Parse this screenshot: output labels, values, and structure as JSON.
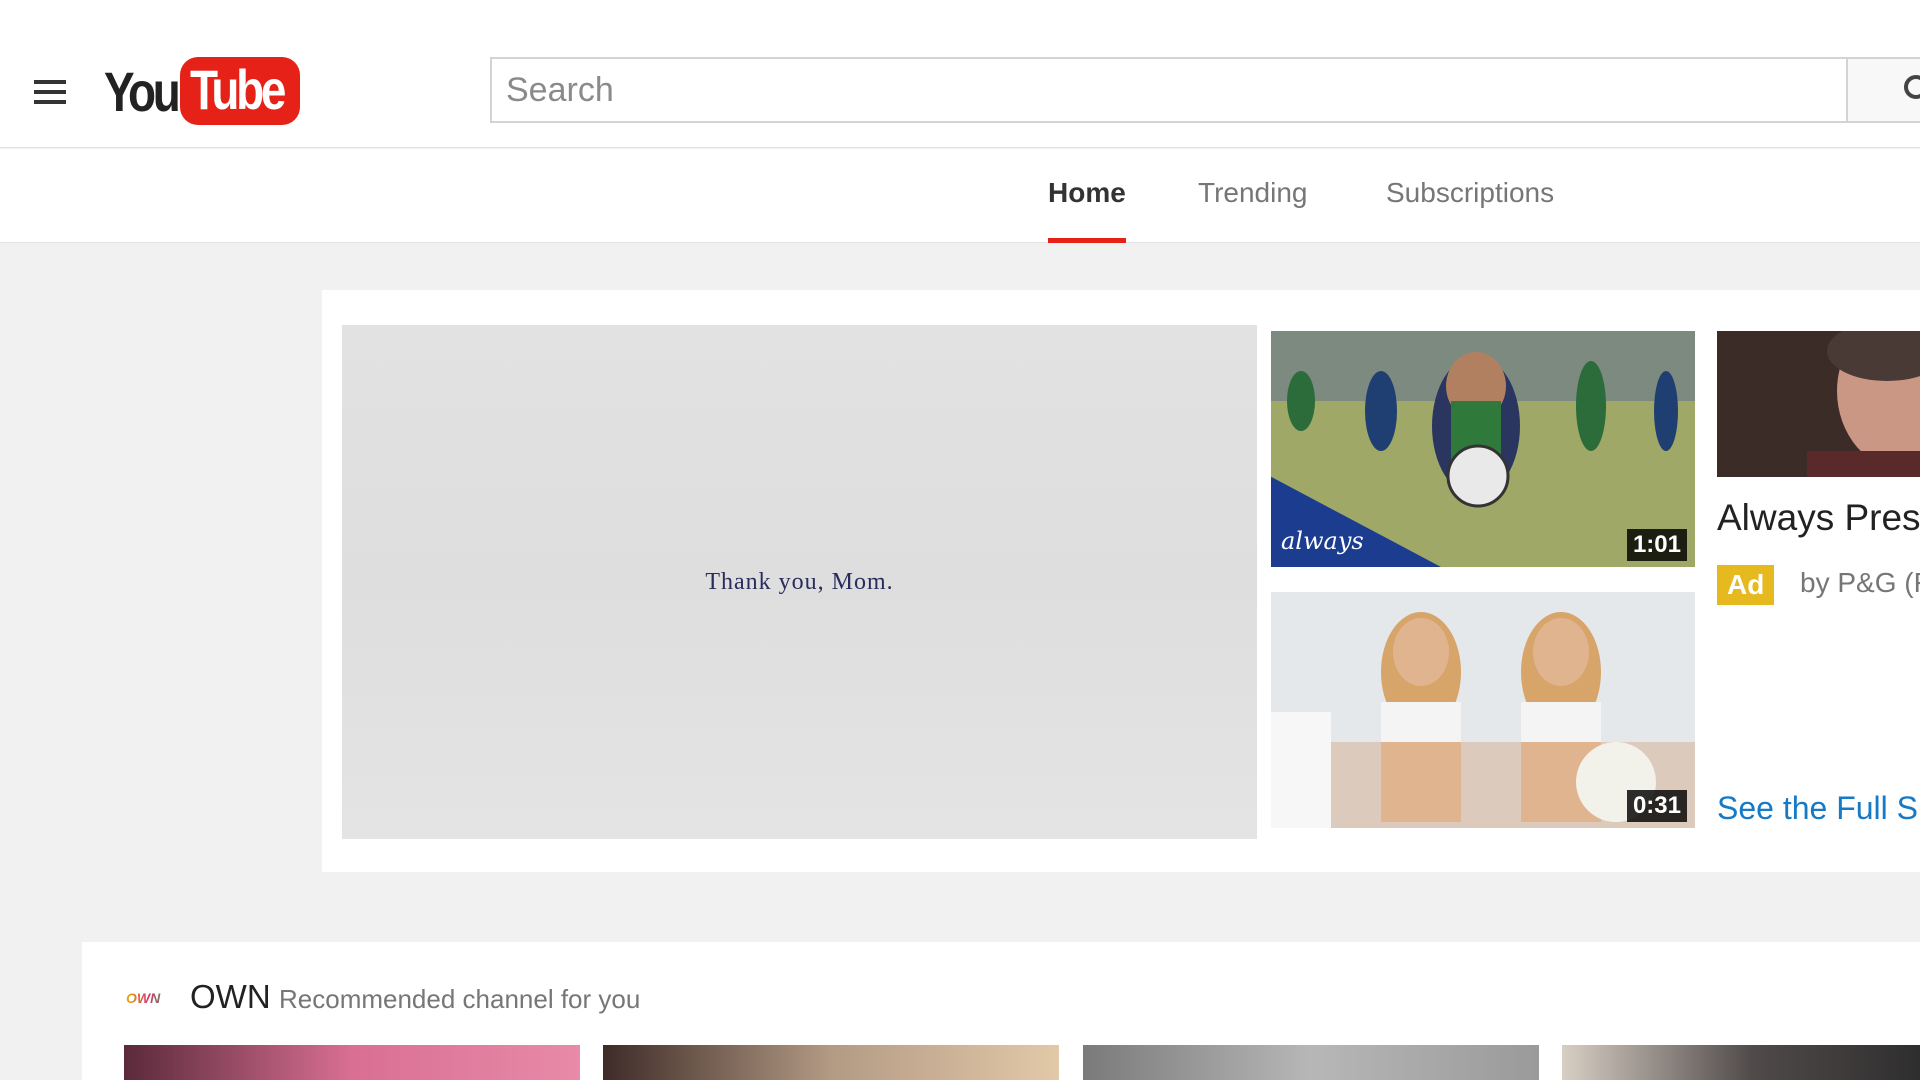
{
  "masthead": {
    "logo_you": "You",
    "logo_tube": "Tube",
    "search_placeholder": "Search"
  },
  "tabs": [
    {
      "label": "Home",
      "active": true
    },
    {
      "label": "Trending",
      "active": false
    },
    {
      "label": "Subscriptions",
      "active": false
    }
  ],
  "promo": {
    "main_video_caption": "Thank you, Mom.",
    "thumbnails": [
      {
        "duration": "1:01",
        "brand_overlay": "always"
      },
      {
        "duration": "0:31"
      }
    ],
    "title": "Always Pres",
    "ad_badge": "Ad",
    "byline": "by P&G (F",
    "link": "See the Full S"
  },
  "channel_shelf": {
    "logo_text": "OWN",
    "channel_name": "OWN",
    "subtitle": "Recommended channel for you"
  },
  "colors": {
    "brand_red": "#e62117",
    "ad_yellow": "#e6b91e",
    "link_blue": "#167ac6"
  }
}
